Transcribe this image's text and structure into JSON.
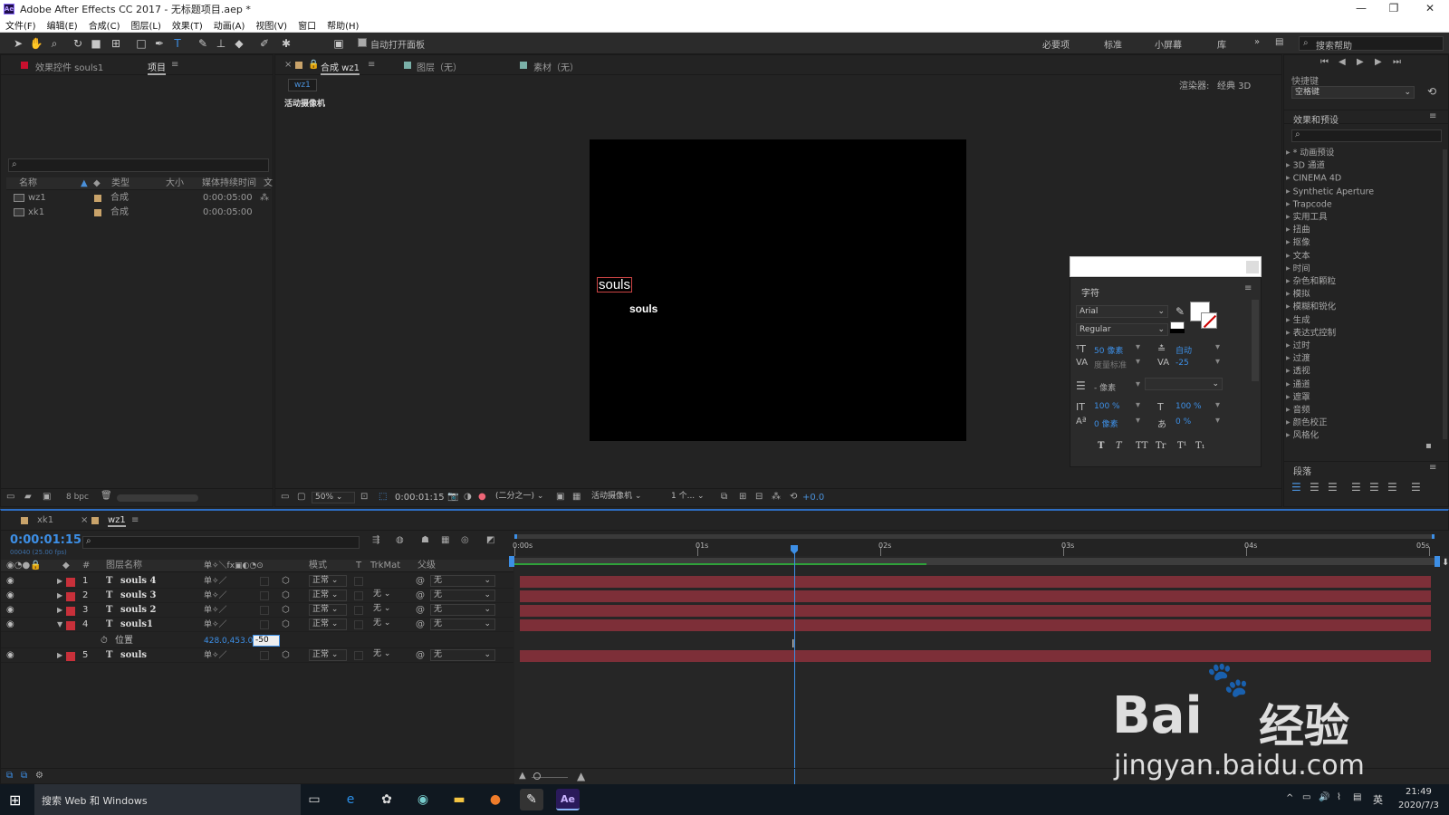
{
  "window": {
    "title": "Adobe After Effects CC 2017 - 无标题项目.aep *",
    "logo": "Ae"
  },
  "menu": [
    "文件(F)",
    "编辑(E)",
    "合成(C)",
    "图层(L)",
    "效果(T)",
    "动画(A)",
    "视图(V)",
    "窗口",
    "帮助(H)"
  ],
  "toolbar": {
    "auto_open": "自动打开面板",
    "workspaces": [
      "必要项",
      "标准",
      "小屏幕",
      "库"
    ],
    "search_help": "搜索帮助"
  },
  "project_panel": {
    "tab_effects": "效果控件 souls1",
    "tab_project": "项目",
    "columns": [
      "名称",
      "类型",
      "大小",
      "媒体持续时间",
      "文"
    ],
    "items": [
      {
        "name": "wz1",
        "type": "合成",
        "duration": "0:00:05:00"
      },
      {
        "name": "xk1",
        "type": "合成",
        "duration": "0:00:05:00"
      }
    ],
    "bpc": "8 bpc"
  },
  "comp_panel": {
    "tab_comp": "合成 wz1",
    "tab_layer": "图层（无）",
    "tab_footage": "素材（无）",
    "subtab": "wz1",
    "renderer_label": "渲染器:",
    "renderer": "经典 3D",
    "camera_label": "活动摄像机",
    "canvas_text_1": "souls",
    "canvas_text_2": "souls",
    "zoom": "50%",
    "timecode": "0:00:01:15",
    "resolution": "(二分之一)",
    "view": "活动摄像机",
    "views": "1 个...",
    "exposure": "+0.0"
  },
  "char_panel": {
    "title": "字符",
    "font": "Arial",
    "style": "Regular",
    "size": "50 像素",
    "leading": "自动",
    "kerning": "度量标准",
    "tracking": "-25",
    "stroke": "- 像素",
    "vscale": "100 %",
    "hscale": "100 %",
    "baseline": "0 像素",
    "tsume": "0 %",
    "styles": [
      "T",
      "T",
      "TT",
      "Tr",
      "T¹",
      "T₁"
    ]
  },
  "right_panel": {
    "preview_label": "快捷键",
    "preview_value": "空格键",
    "effects_title": "效果和预设",
    "effects": [
      "* 动画预设",
      "3D 通道",
      "CINEMA 4D",
      "Synthetic Aperture",
      "Trapcode",
      "实用工具",
      "扭曲",
      "抠像",
      "文本",
      "时间",
      "杂色和颗粒",
      "模拟",
      "模糊和锐化",
      "生成",
      "表达式控制",
      "过时",
      "过渡",
      "透视",
      "通道",
      "遮罩",
      "音频",
      "颜色校正",
      "风格化"
    ],
    "paragraph_title": "段落"
  },
  "timeline": {
    "tab_xk1": "xk1",
    "tab_wz1": "wz1",
    "timecode": "0:00:01:15",
    "frames": "00040 (25.00 fps)",
    "col_name": "图层名称",
    "col_mode": "模式",
    "col_t": "T",
    "col_trkmat": "TrkMat",
    "col_parent": "父级",
    "layers": [
      {
        "num": "1",
        "name": "souls 4",
        "mode": "正常",
        "trkmat": "",
        "parent": "无"
      },
      {
        "num": "2",
        "name": "souls 3",
        "mode": "正常",
        "trkmat": "无",
        "parent": "无"
      },
      {
        "num": "3",
        "name": "souls 2",
        "mode": "正常",
        "trkmat": "无",
        "parent": "无"
      },
      {
        "num": "4",
        "name": "souls1",
        "mode": "正常",
        "trkmat": "无",
        "parent": "无"
      },
      {
        "num": "5",
        "name": "souls",
        "mode": "正常",
        "trkmat": "无",
        "parent": "无"
      }
    ],
    "position_label": "位置",
    "position_value": "428.0,453.0,",
    "position_edit": "-50",
    "ruler": [
      "0:00s",
      "01s",
      "02s",
      "03s",
      "04s",
      "05s"
    ],
    "playhead_fraction": 0.3,
    "work_area_fraction": 0.45
  },
  "taskbar": {
    "search": "搜索 Web 和 Windows",
    "time": "21:49",
    "date": "2020/7/3",
    "lang": "英"
  },
  "watermark": {
    "brand": "Bai",
    "brand2": "经验",
    "url": "jingyan.baidu.com"
  }
}
